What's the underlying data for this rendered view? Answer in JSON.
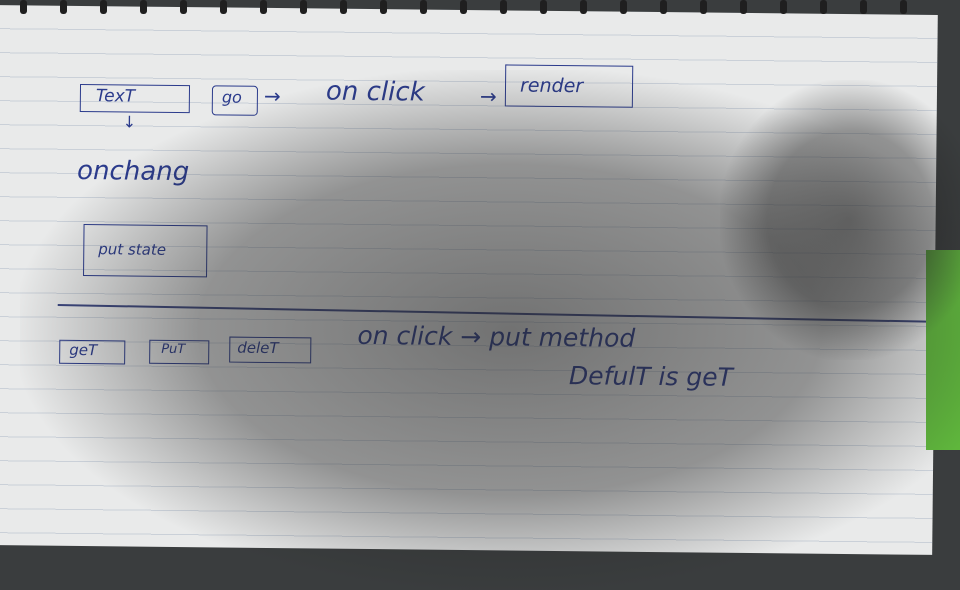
{
  "notes": {
    "top": {
      "text_box": "TexT",
      "go_button": "go",
      "on_click": "on click",
      "render_box": "render",
      "onchange": "onchang",
      "put_state": "put state"
    },
    "bottom": {
      "get_button": "geT",
      "put_button": "PuT",
      "delete_button": "deleT",
      "on_click_put": "on click → put method",
      "default_get": "DefulT is geT"
    }
  }
}
